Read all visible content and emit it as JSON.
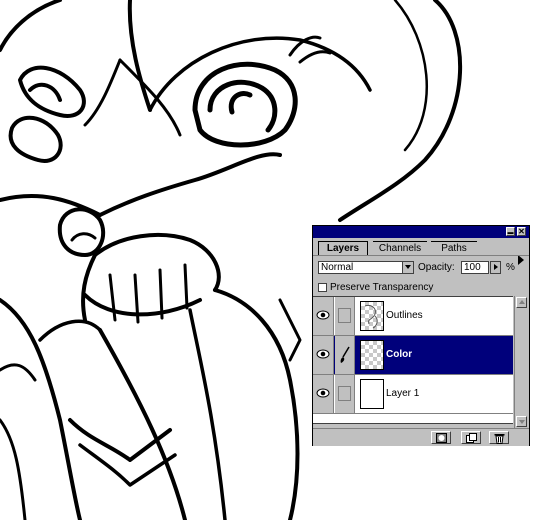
{
  "palette": {
    "minimize_glyph": "▬",
    "close_glyph": "✕",
    "tabs": [
      {
        "label": "Layers",
        "active": true
      },
      {
        "label": "Channels",
        "active": false
      },
      {
        "label": "Paths",
        "active": false
      }
    ],
    "blend_mode": "Normal",
    "opacity_label": "Opacity:",
    "opacity_value": "100",
    "opacity_unit": "%",
    "preserve_transparency_label": "Preserve Transparency",
    "preserve_transparency_checked": false,
    "layers": [
      {
        "name": "Outlines",
        "visible": true,
        "selected": false
      },
      {
        "name": "Color",
        "visible": true,
        "selected": true
      },
      {
        "name": "Layer 1",
        "visible": true,
        "selected": false
      }
    ],
    "bottom_buttons": [
      "layer-mask-icon",
      "new-layer-icon",
      "trash-icon"
    ]
  },
  "colors": {
    "titlebar": "#00007b",
    "selection": "#00007b",
    "chrome": "#c0c0c0",
    "canvas": "#ffffff"
  }
}
